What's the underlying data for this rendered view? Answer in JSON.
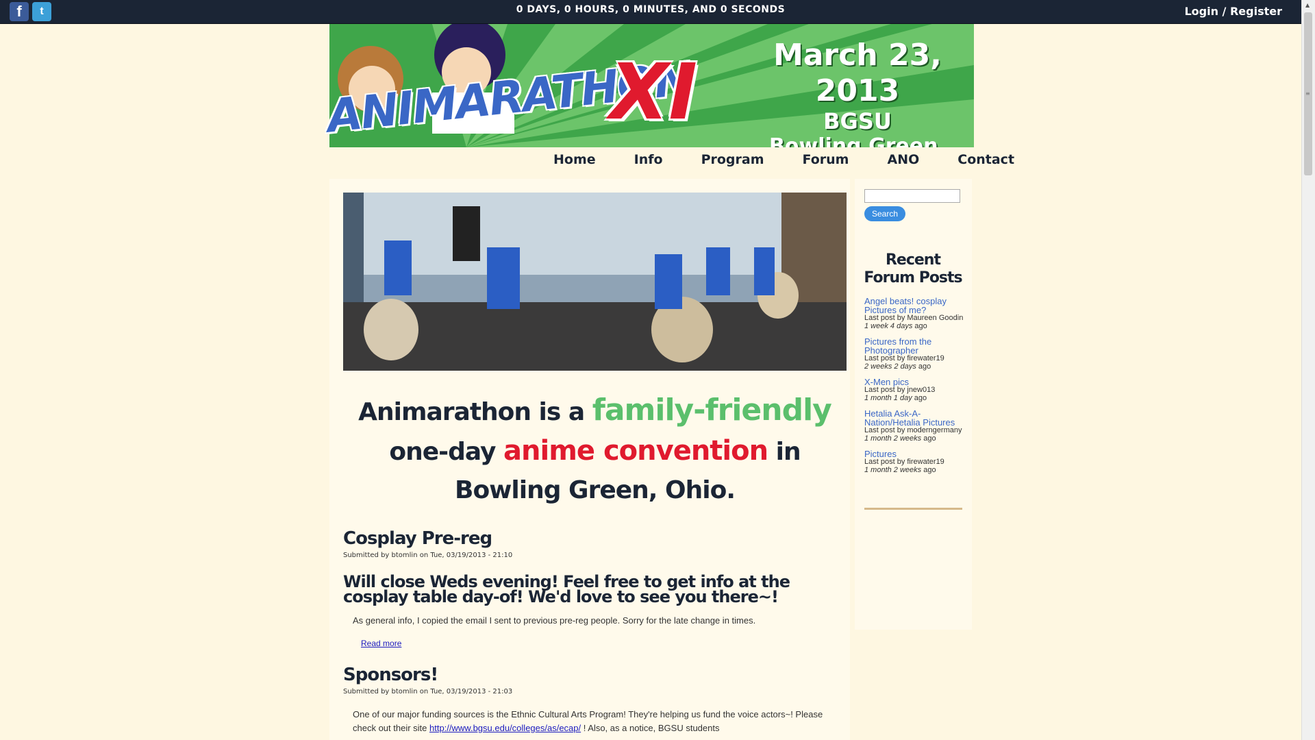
{
  "topbar": {
    "countdown": "0 DAYS, 0 HOURS, 0 MINUTES, AND 0 SECONDS",
    "login": "Login",
    "separator": "/",
    "register": "Register",
    "facebook_icon": "f",
    "twitter_icon": "t"
  },
  "banner": {
    "logo_word": "ANIMARATHON",
    "logo_numeral": "XI",
    "date": "March 23, 2013",
    "venue": "BGSU",
    "city": "Bowling Green, OH"
  },
  "nav": [
    "Home",
    "Info",
    "Program",
    "Forum",
    "ANO",
    "Contact"
  ],
  "tagline": {
    "part1": "Animarathon is a",
    "highlight1": "family-friendly",
    "part2": "one-day",
    "highlight2": "anime convention",
    "part3": "in",
    "part4": "Bowling Green, Ohio."
  },
  "posts": [
    {
      "title": "Cosplay Pre-reg",
      "meta": "Submitted by btomlin on Tue, 03/19/2013 - 21:10",
      "headline": "Will close Weds evening! Feel free to get info at the cosplay table day-of! We'd love to see you there~!",
      "body": "As general info, I copied the email I sent to previous pre-reg people. Sorry for the late change in times.",
      "read_more": "Read more"
    },
    {
      "title": "Sponsors!",
      "meta": "Submitted by btomlin on Tue, 03/19/2013 - 21:03",
      "body_before": "One of our major funding sources is the Ethnic Cultural Arts Program! They're helping us fund the voice actors~! Please check out their site ",
      "link": "http://www.bgsu.edu/colleges/as/ecap/",
      "body_after": "! Also, as a notice, BGSU students"
    }
  ],
  "sidebar": {
    "search_button": "Search",
    "search_value": "",
    "forum_title_line1": "Recent",
    "forum_title_line2": "Forum Posts",
    "forum_posts": [
      {
        "title": "Angel beats! cosplay Pictures of me?",
        "by": "Last post by Maureen Goodin",
        "ago_em": "1 week 4 days",
        "ago_tail": "ago"
      },
      {
        "title": "Pictures from the Photographer",
        "by": "Last post by firewater19",
        "ago_em": "2 weeks 2 days",
        "ago_tail": "ago"
      },
      {
        "title": "X-Men pics",
        "by": "Last post by jnew013",
        "ago_em": "1 month 1 day",
        "ago_tail": "ago"
      },
      {
        "title": "Hetalia Ask-A-Nation/Hetalia Pictures",
        "by": "Last post by moderngermany",
        "ago_em": "1 month 2 weeks",
        "ago_tail": "ago"
      },
      {
        "title": "Pictures",
        "by": "Last post by firewater19",
        "ago_em": "1 month 2 weeks",
        "ago_tail": "ago"
      }
    ]
  },
  "colors": {
    "topbar": "#1b2535",
    "page_bg": "#fef7e1",
    "banner_green": "#3fa64a",
    "accent_green": "#5bbf6c",
    "accent_red": "#e01a2e",
    "logo_blue": "#3a67c6",
    "link_blue": "#1a1abe"
  }
}
